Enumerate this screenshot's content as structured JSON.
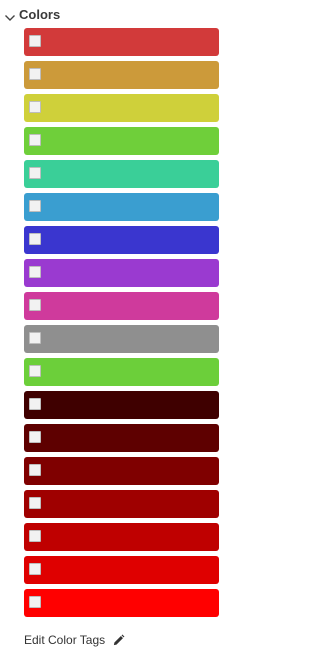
{
  "panel": {
    "title": "Colors",
    "edit_label": "Edit Color Tags"
  },
  "colors": [
    {
      "hex": "#d23a3a",
      "checked": false
    },
    {
      "hex": "#cc9a3a",
      "checked": false
    },
    {
      "hex": "#cfd03a",
      "checked": false
    },
    {
      "hex": "#6fcf3a",
      "checked": false
    },
    {
      "hex": "#3acf98",
      "checked": false
    },
    {
      "hex": "#3a9ed0",
      "checked": false
    },
    {
      "hex": "#3a36cf",
      "checked": false
    },
    {
      "hex": "#9a3ad0",
      "checked": false
    },
    {
      "hex": "#cf3a9c",
      "checked": false
    },
    {
      "hex": "#8f8f8f",
      "checked": false
    },
    {
      "hex": "#6ccf3a",
      "checked": false
    },
    {
      "hex": "#3f0000",
      "checked": false
    },
    {
      "hex": "#5e0000",
      "checked": false
    },
    {
      "hex": "#7f0000",
      "checked": false
    },
    {
      "hex": "#9f0000",
      "checked": false
    },
    {
      "hex": "#bf0000",
      "checked": false
    },
    {
      "hex": "#df0000",
      "checked": false
    },
    {
      "hex": "#ff0000",
      "checked": false
    }
  ],
  "icons": {
    "collapse": "chevron-down-icon",
    "edit": "pencil-icon",
    "checkbox": "checkbox"
  }
}
